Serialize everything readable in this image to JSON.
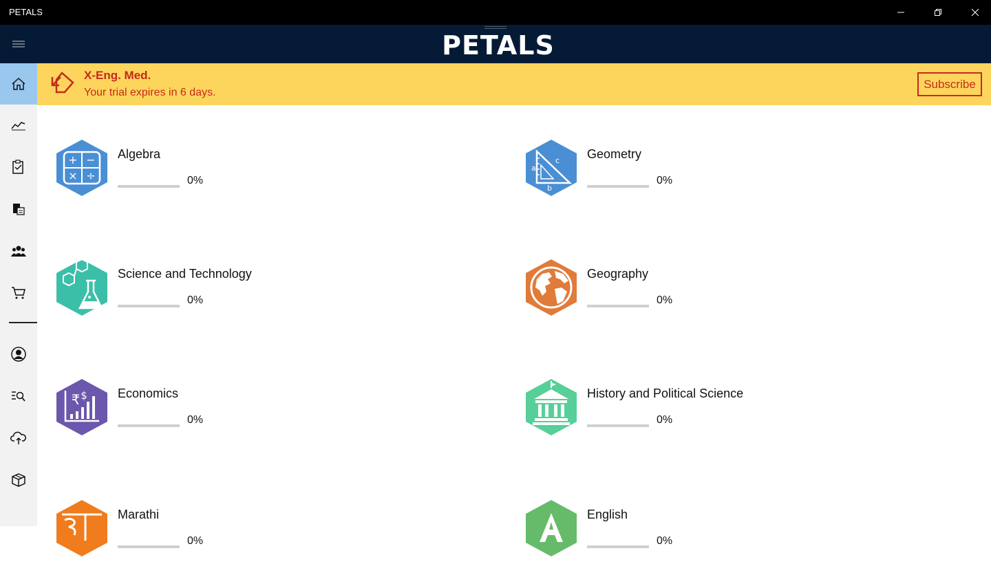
{
  "window": {
    "title": "PETALS"
  },
  "header": {
    "logo": "PETALS"
  },
  "sidebar": {
    "items": [
      {
        "name": "home",
        "icon": "home-icon",
        "active": true
      },
      {
        "name": "progress",
        "icon": "chart-line-icon"
      },
      {
        "name": "tests",
        "icon": "clipboard-icon"
      },
      {
        "name": "documents",
        "icon": "document-icon"
      },
      {
        "name": "community",
        "icon": "group-icon"
      },
      {
        "name": "cart",
        "icon": "cart-icon"
      },
      {
        "name": "profile",
        "icon": "person-icon"
      },
      {
        "name": "search",
        "icon": "search-list-icon"
      },
      {
        "name": "sync",
        "icon": "cloud-sync-icon"
      },
      {
        "name": "packages",
        "icon": "package-icon"
      }
    ]
  },
  "banner": {
    "title": "X-Eng. Med.",
    "subtitle": "Your trial expires in 6 days.",
    "subscribe_label": "Subscribe",
    "color": "#c42b1c",
    "background": "#fdd55c"
  },
  "subjects": [
    {
      "name": "Algebra",
      "progress": 0,
      "progress_label": "0%",
      "color": "#4a8fd4",
      "icon": "calculator-icon"
    },
    {
      "name": "Geometry",
      "progress": 0,
      "progress_label": "0%",
      "color": "#4a8fd4",
      "icon": "triangle-ruler-icon"
    },
    {
      "name": "Science and Technology",
      "progress": 0,
      "progress_label": "0%",
      "color": "#3cbfa9",
      "icon": "flask-icon"
    },
    {
      "name": "Geography",
      "progress": 0,
      "progress_label": "0%",
      "color": "#e07b39",
      "icon": "globe-icon"
    },
    {
      "name": "Economics",
      "progress": 0,
      "progress_label": "0%",
      "color": "#6b57ab",
      "icon": "rupee-chart-icon"
    },
    {
      "name": "History and Political Science",
      "progress": 0,
      "progress_label": "0%",
      "color": "#57cf98",
      "icon": "building-icon"
    },
    {
      "name": "Marathi",
      "progress": 0,
      "progress_label": "0%",
      "color": "#f07c1e",
      "icon": "marathi-letter-icon"
    },
    {
      "name": "English",
      "progress": 0,
      "progress_label": "0%",
      "color": "#66bb6a",
      "icon": "letter-a-icon"
    }
  ]
}
